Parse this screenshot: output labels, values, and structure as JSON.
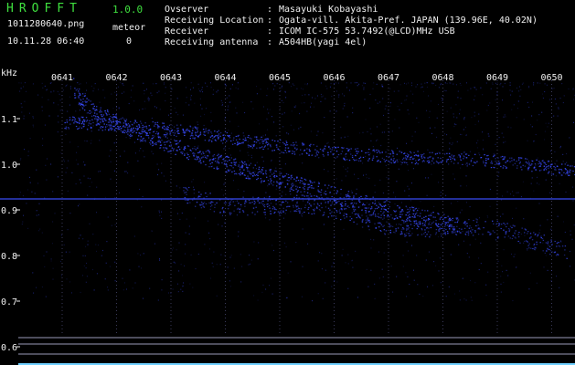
{
  "header": {
    "app_title": "HROFFT",
    "app_version": "1.0.0",
    "file_name": "1011280640.png",
    "timestamp": "10.11.28 06:40",
    "meteor_label": "meteor",
    "meteor_count": "0"
  },
  "info": [
    {
      "label": "Ovserver",
      "value": "Masayuki Kobayashi"
    },
    {
      "label": "Receiving Location",
      "value": "Ogata-vill. Akita-Pref. JAPAN (139.96E, 40.02N)"
    },
    {
      "label": "Receiver",
      "value": "ICOM IC-575 53.7492(@LCD)MHz USB"
    },
    {
      "label": "Receiving antenna",
      "value": "A504HB(yagi 4el)"
    }
  ],
  "spectrogram": {
    "y_unit": "kHz",
    "y_ticks": [
      "1.1",
      "1.0",
      "0.9",
      "0.8",
      "0.7",
      "0.6"
    ],
    "x_ticks": [
      "0641",
      "0642",
      "0643",
      "0644",
      "0645",
      "0646",
      "0647",
      "0648",
      "0649",
      "0650"
    ],
    "colors": {
      "background": "#000000",
      "signal": "#3a4cff",
      "grid": "#3a3a5a",
      "text": "#f0f0f0",
      "title": "#3fe03f"
    }
  }
}
